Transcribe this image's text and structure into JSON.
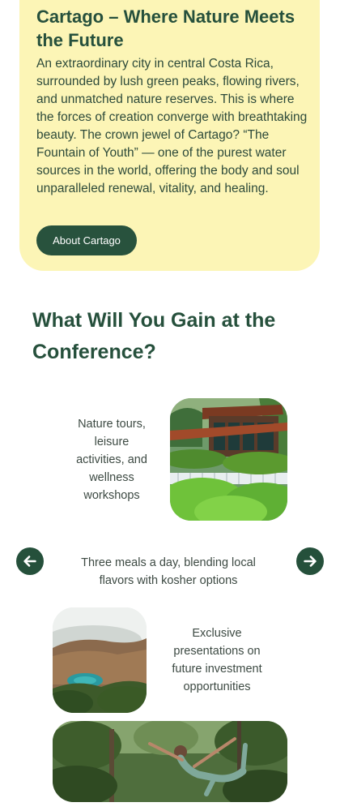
{
  "hero": {
    "title": "Cartago – Where Nature Meets the Future",
    "description": "An extraordinary city in central Costa Rica, surrounded by lush green peaks, flowing rivers, and unmatched nature reserves. This is where the forces of creation converge with breathtaking beauty. The crown jewel of Cartago? “The Fountain of Youth” — one of the purest water sources in the world, offering the body and soul unparalleled renewal, vitality, and healing.",
    "button_label": "About Cartago"
  },
  "gains": {
    "title": "What Will You Gain at the Conference?",
    "items": [
      {
        "text": "Nature tours, leisure activities, and wellness workshops",
        "image": "eco-lodge-photo"
      },
      {
        "text": "Three meals a day, blending local flavors with kosher options"
      },
      {
        "text": "Exclusive presentations on future investment opportunities",
        "image": "volcano-crater-lake-photo"
      },
      {
        "image": "yoga-in-forest-photo"
      }
    ],
    "prev_icon": "arrow-left-icon",
    "next_icon": "arrow-right-icon"
  },
  "colors": {
    "hero_background": "#fcf5b6",
    "primary_green": "#26503c"
  }
}
